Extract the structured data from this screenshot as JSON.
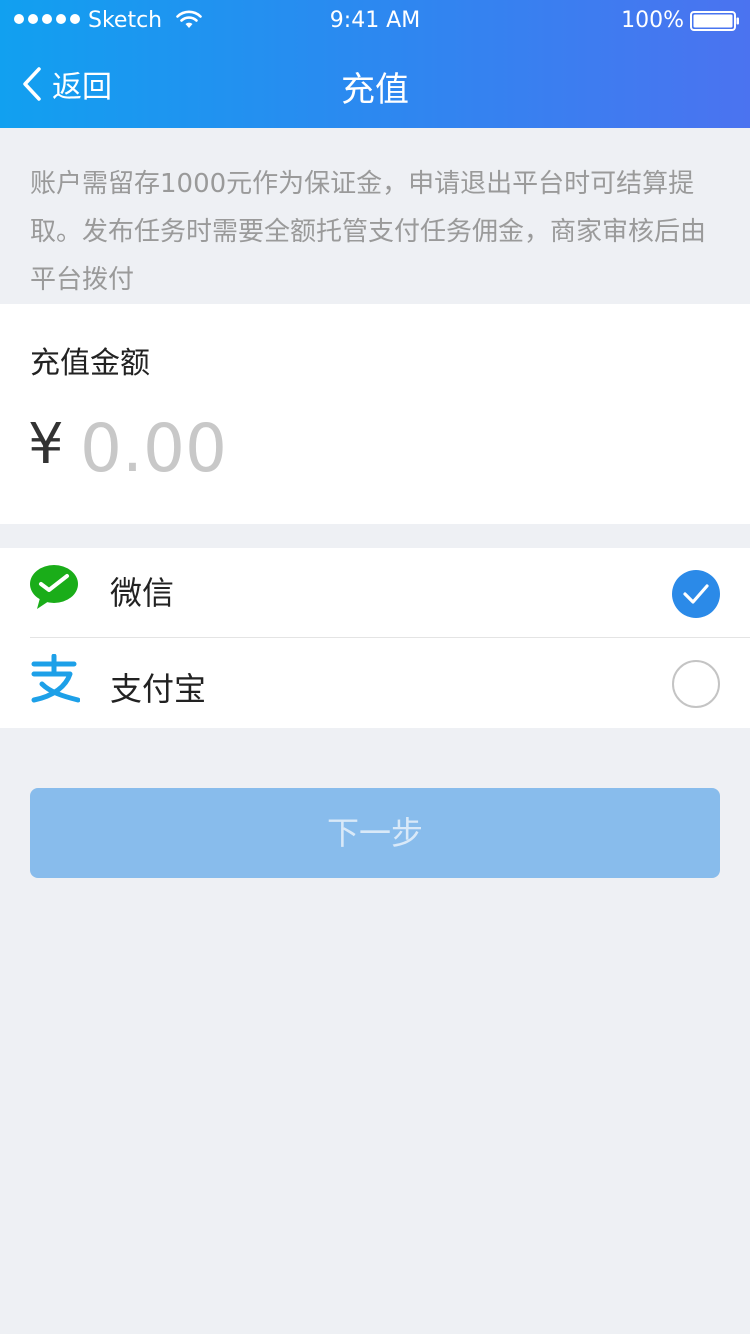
{
  "status_bar": {
    "carrier": "Sketch",
    "time": "9:41 AM",
    "battery": "100%"
  },
  "nav": {
    "back_label": "返回",
    "title": "充值"
  },
  "notice": "账户需留存1000元作为保证金，申请退出平台时可结算提取。发布任务时需要全额托管支付任务佣金，商家审核后由平台拨付",
  "amount": {
    "label": "充值金额",
    "currency_symbol": "¥",
    "placeholder": "0.00",
    "value": ""
  },
  "payment_methods": [
    {
      "label": "微信",
      "icon": "wechat-icon",
      "selected": true
    },
    {
      "label": "支付宝",
      "icon": "alipay-icon",
      "selected": false
    }
  ],
  "next_button_label": "下一步",
  "colors": {
    "header_start": "#11a0f0",
    "header_end": "#4b73f0",
    "check_blue": "#2b8ae8",
    "wechat_green": "#1aad19",
    "alipay_blue": "#1da0e8",
    "button_disabled": "#88bcec"
  }
}
